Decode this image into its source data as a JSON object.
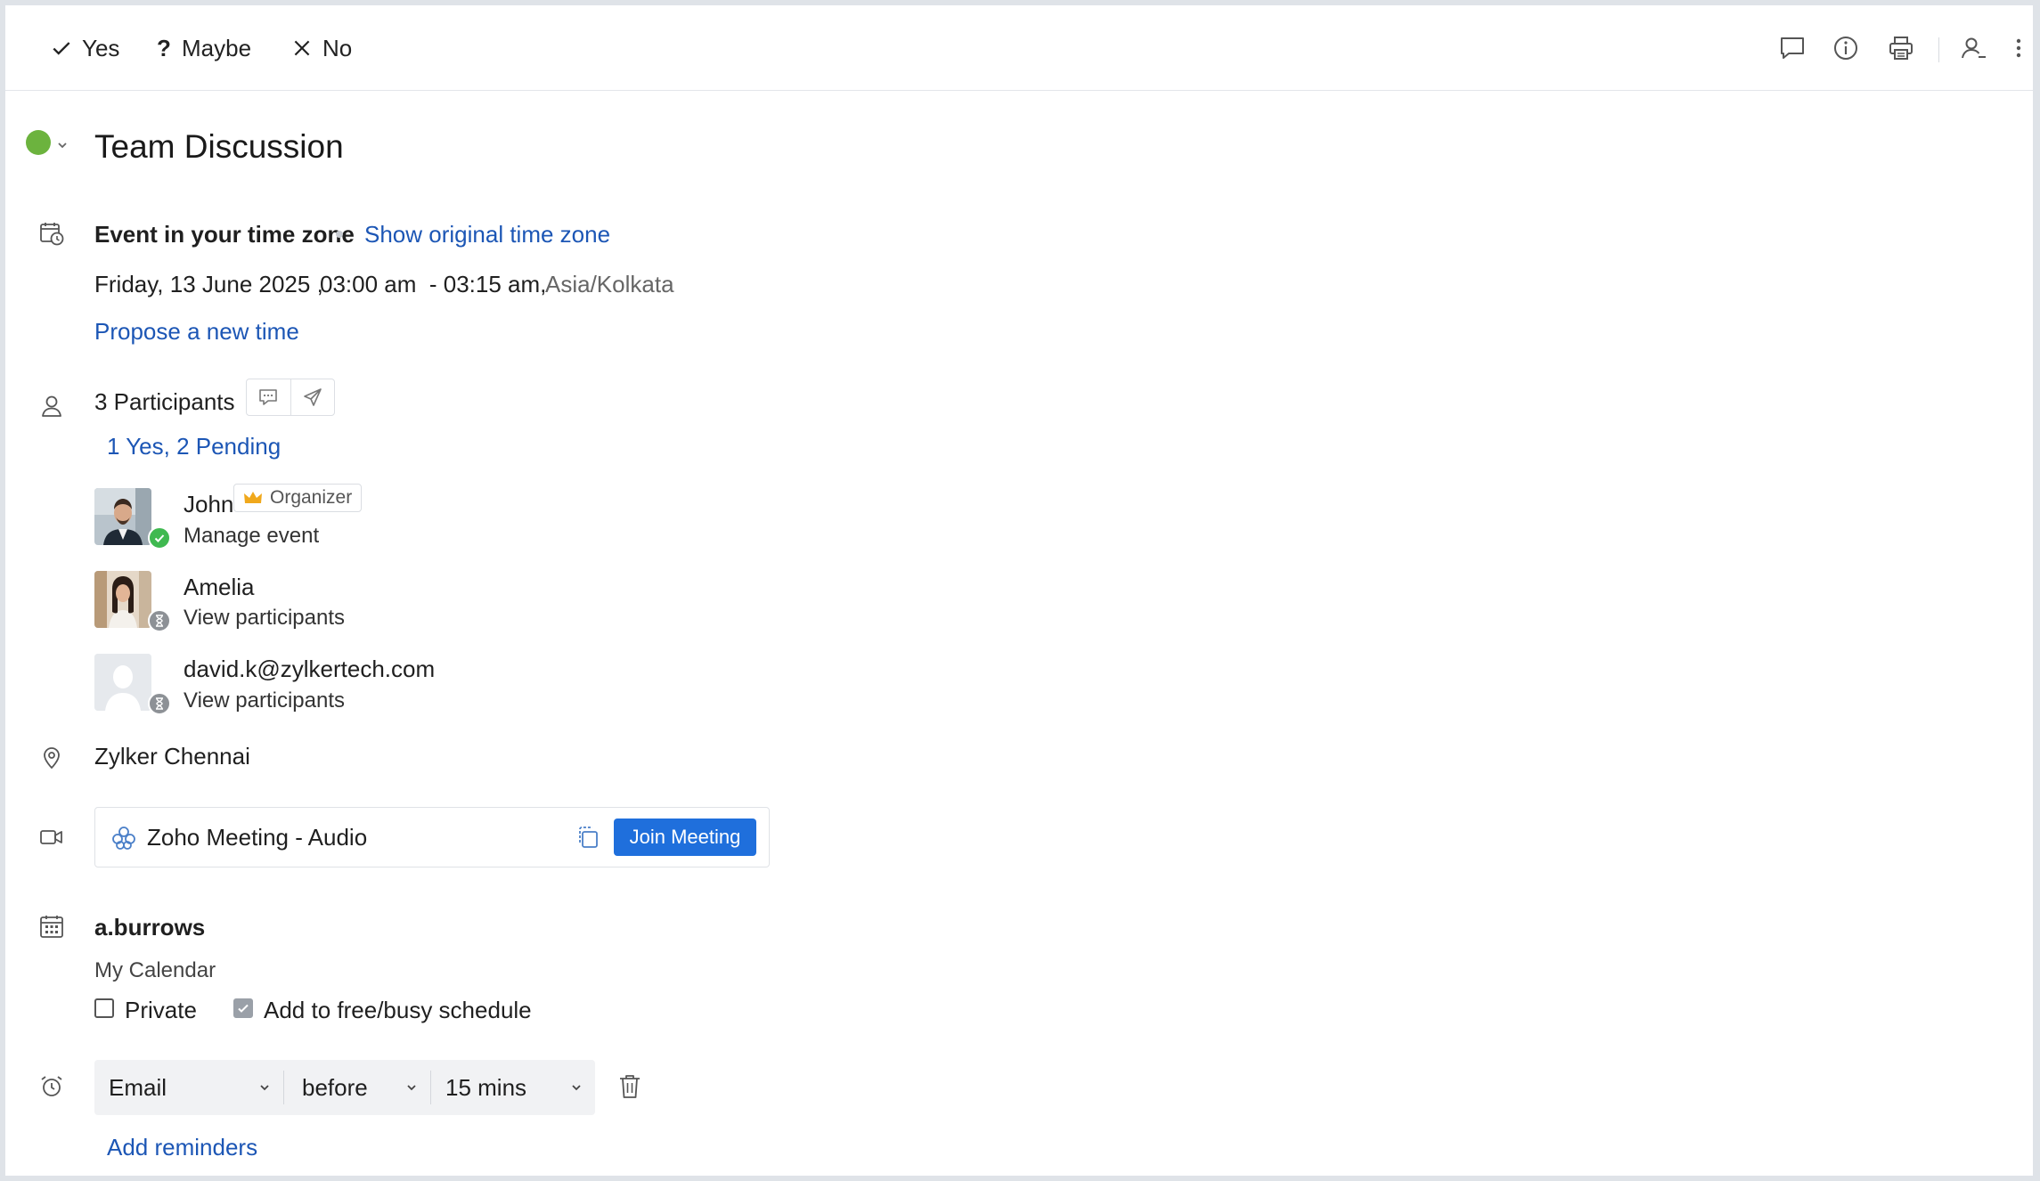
{
  "toolbar": {
    "rsvp": {
      "yes": "Yes",
      "maybe": "Maybe",
      "no": "No"
    },
    "icons": [
      "comment-icon",
      "info-icon",
      "print-icon",
      "user-menu-icon",
      "more-icon"
    ]
  },
  "event": {
    "title": "Team Discussion",
    "status_color": "#6cb33e",
    "timezone_heading": "Event in your time zone",
    "show_original_tz": "Show original time zone",
    "date": "Friday, 13 June 2025 ,",
    "time_range": "03:00 am  - 03:15 am,",
    "timezone": "Asia/Kolkata",
    "propose_time": "Propose a new time"
  },
  "participants": {
    "heading": "3 Participants",
    "summary": "1 Yes, 2 Pending",
    "organizer_label": "Organizer",
    "list": [
      {
        "name": "John",
        "action": "Manage event",
        "status": "yes"
      },
      {
        "name": "Amelia",
        "action": "View participants",
        "status": "pending"
      },
      {
        "name": "david.k@zylkertech.com",
        "action": "View participants",
        "status": "pending"
      }
    ]
  },
  "location": "Zylker Chennai",
  "meeting": {
    "name": "Zoho Meeting - Audio",
    "join_label": "Join Meeting",
    "accent": "#1f6fdc"
  },
  "calendar": {
    "owner": "a.burrows",
    "name": "My Calendar",
    "private_label": "Private",
    "private_checked": false,
    "freebusy_label": "Add to free/busy schedule",
    "freebusy_checked": true
  },
  "reminder": {
    "type": "Email",
    "when": "before",
    "duration": "15 mins",
    "add_label": "Add reminders"
  }
}
